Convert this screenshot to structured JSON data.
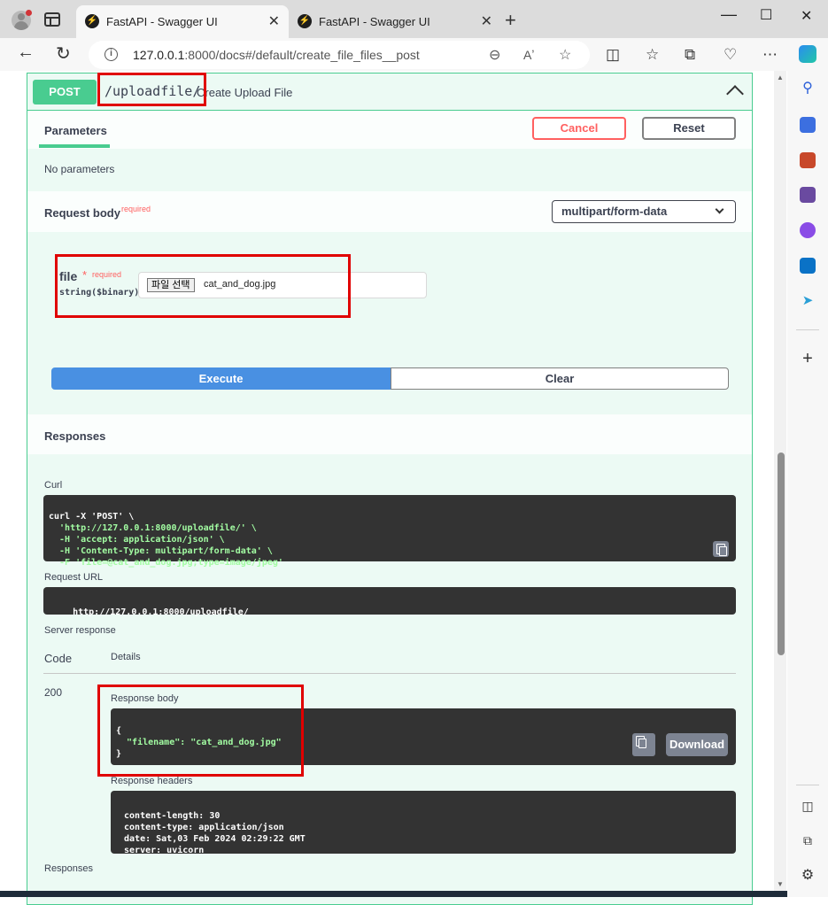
{
  "browser": {
    "tabs": [
      {
        "title": "FastAPI - Swagger UI",
        "active": true
      },
      {
        "title": "FastAPI - Swagger UI",
        "active": false
      }
    ],
    "url_host": "127.0.0.1",
    "url_rest": ":8000/docs#/default/create_file_files__post"
  },
  "operation": {
    "method": "POST",
    "path": "/uploadfile/",
    "summary": "Create Upload File",
    "parameters_tab": "Parameters",
    "cancel_label": "Cancel",
    "reset_label": "Reset",
    "no_parameters": "No parameters",
    "request_body_title": "Request body",
    "required_label": "required",
    "content_type": "multipart/form-data"
  },
  "form": {
    "field_name": "file",
    "required_star": "*",
    "required_label": "required",
    "field_type": "string($binary)",
    "choose_file_label": "파일 선택",
    "file_name": "cat_and_dog.jpg",
    "execute_label": "Execute",
    "clear_label": "Clear"
  },
  "responses": {
    "title": "Responses",
    "curl_label": "Curl",
    "curl_lines": [
      "curl -X 'POST' \\",
      "  'http://127.0.0.1:8000/uploadfile/' \\",
      "  -H 'accept: application/json' \\",
      "  -H 'Content-Type: multipart/form-data' \\",
      "  -F 'file=@cat_and_dog.jpg;type=image/jpeg'"
    ],
    "request_url_label": "Request URL",
    "request_url": "http://127.0.0.1:8000/uploadfile/",
    "server_response_label": "Server response",
    "code_header": "Code",
    "details_header": "Details",
    "status_code": "200",
    "response_body_label": "Response body",
    "response_body_lines": [
      "{",
      "  \"filename\": \"cat_and_dog.jpg\"",
      "}"
    ],
    "download_label": "Download",
    "response_headers_label": "Response headers",
    "response_headers_lines": [
      " content-length: 30",
      " content-type: application/json",
      " date: Sat,03 Feb 2024 02:29:22 GMT",
      " server: uvicorn"
    ],
    "footer_title": "Responses"
  }
}
